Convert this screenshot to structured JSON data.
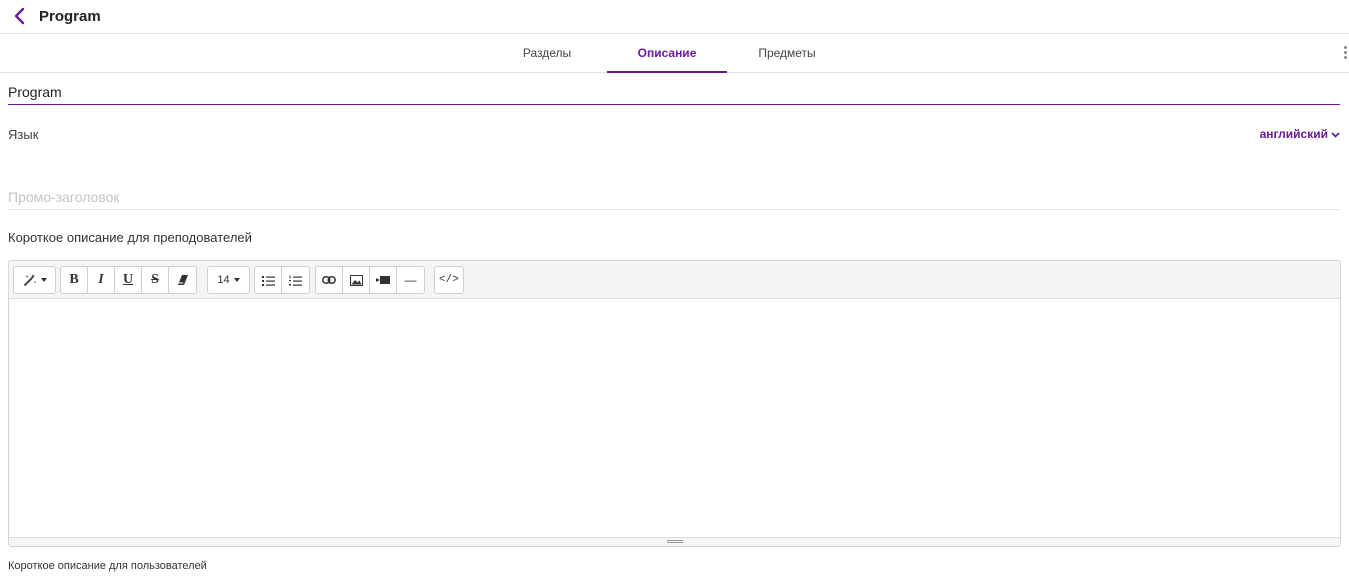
{
  "header": {
    "title": "Program",
    "back_icon": "chevron-left-icon",
    "accent": "#6a1b9a"
  },
  "tabs": [
    {
      "label": "Разделы",
      "active": false
    },
    {
      "label": "Описание",
      "active": true
    },
    {
      "label": "Предметы",
      "active": false
    }
  ],
  "form": {
    "name_value": "Program",
    "language_label": "Язык",
    "language_value": "английский",
    "promo_placeholder": "Промо-заголовок",
    "teacher_desc_label": "Короткое описание для преподователей",
    "user_desc_label": "Короткое описание для пользователей"
  },
  "editor": {
    "font_size": "14",
    "toolbar_icons": [
      "magic-wand-icon",
      "bold-icon",
      "italic-icon",
      "underline-icon",
      "strikethrough-icon",
      "eraser-icon",
      "font-size-select",
      "bullet-list-icon",
      "numbered-list-icon",
      "link-icon",
      "image-icon",
      "video-icon",
      "horizontal-rule-icon",
      "code-view-icon"
    ],
    "labels": {
      "bold": "B",
      "italic": "I",
      "underline": "U",
      "strike": "S",
      "hr": "—",
      "code": "</>"
    }
  }
}
